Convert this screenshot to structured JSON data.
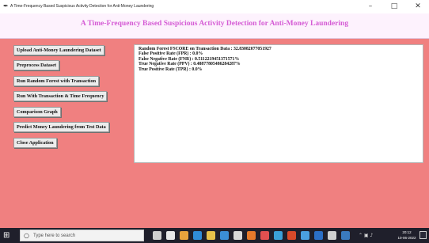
{
  "window": {
    "title": "A Time-Frequency Based Suspicious Activity Detection for Anti-Money Laundering",
    "minimize": "–",
    "maximize": "□",
    "close": "✕"
  },
  "header": {
    "title": "A Time-Frequency Based Suspicious Activity Detection for Anti-Money Laundering"
  },
  "buttons": [
    {
      "label": "Upload Anti-Money Laundering Dataset"
    },
    {
      "label": "Preprocess Dataset"
    },
    {
      "label": "Run Random Forest with Transaction"
    },
    {
      "label": "Run With Transaction & Time Frequency"
    },
    {
      "label": "Comparison Graph"
    },
    {
      "label": "Predict Money Laundering from Test Data"
    },
    {
      "label": "Close Application"
    }
  ],
  "output": {
    "lines": [
      "Random Forest FSCORE on Transaction Data : 32.83082077051927",
      "False Positive Rate (FPR) : 0.0%",
      "False Negative Rate (FNR) : 0.5112219451371571%",
      "True Negative Rate (PPV) : 0.48877805486284287%",
      "True Positive Rate (TPR) : 0.0%"
    ]
  },
  "taskbar": {
    "search_placeholder": "Type here to search",
    "clock_time": "20:12",
    "clock_date": "10-06-2022",
    "icons": [
      {
        "name": "mic-icon",
        "color": "#cfcfcf"
      },
      {
        "name": "task-view-icon",
        "color": "#e8e8e8"
      },
      {
        "name": "chrome-icon",
        "color": "#e8a33c"
      },
      {
        "name": "edge-icon",
        "color": "#2f8cd8"
      },
      {
        "name": "file-explorer-icon",
        "color": "#e8c24a"
      },
      {
        "name": "store-icon",
        "color": "#3b8ed6"
      },
      {
        "name": "mail-icon",
        "color": "#d9d9d9"
      },
      {
        "name": "firefox-icon",
        "color": "#e5792b"
      },
      {
        "name": "app-icon",
        "color": "#e05050"
      },
      {
        "name": "app-icon",
        "color": "#3aa0d8"
      },
      {
        "name": "powerpoint-icon",
        "color": "#d84a2a"
      },
      {
        "name": "app-icon",
        "color": "#4aa0e0"
      },
      {
        "name": "word-icon",
        "color": "#2b6fc6"
      },
      {
        "name": "app-icon",
        "color": "#d0d0d0"
      },
      {
        "name": "python-icon",
        "color": "#3a7abf"
      }
    ]
  }
}
